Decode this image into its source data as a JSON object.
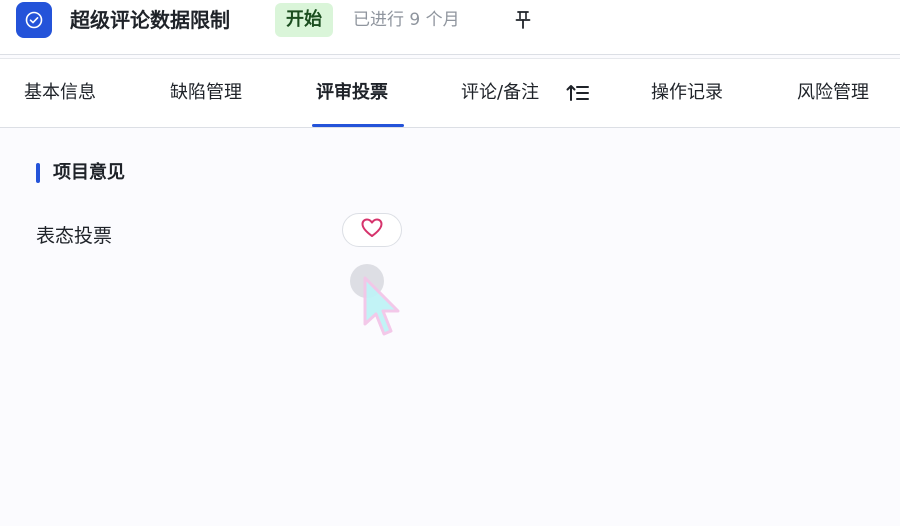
{
  "header": {
    "title": "超级评论数据限制",
    "status": "开始",
    "elapsed": "已进行 9 个月"
  },
  "tabs": [
    {
      "label": "基本信息",
      "active": false
    },
    {
      "label": "缺陷管理",
      "active": false
    },
    {
      "label": "评审投票",
      "active": true
    },
    {
      "label": "评论/备注",
      "active": false
    },
    {
      "label": "操作记录",
      "active": false
    },
    {
      "label": "风险管理",
      "active": false
    }
  ],
  "section": {
    "title": "项目意见"
  },
  "vote": {
    "label": "表态投票",
    "icon": "heart-icon"
  },
  "colors": {
    "accent": "#2453d9",
    "status_bg": "#daf5d9",
    "heart": "#d6336c"
  },
  "icons": {
    "app": "check-circle-icon",
    "pin": "pin-icon",
    "sort": "sort-ascending-icon"
  }
}
